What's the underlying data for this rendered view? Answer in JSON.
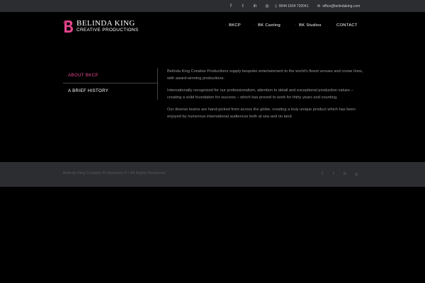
{
  "topbar": {
    "social_icons": [
      "f",
      "t",
      "in",
      "◎"
    ],
    "phone_icon": "▯",
    "phone": "0044 1604 720041",
    "email_icon": "✉",
    "email": "office@belindaking.com"
  },
  "logo": {
    "mark_letter": "B",
    "name": "BELINDA KING",
    "subtitle": "CREATIVE PRODUCTIONS"
  },
  "nav": {
    "items": [
      {
        "label": "BKCP",
        "bullet": "◦"
      },
      {
        "label": "BK Casting",
        "bullet": "◦"
      },
      {
        "label": "BK Studios",
        "bullet": "◦"
      },
      {
        "label": "CONTACT",
        "bullet": ""
      }
    ]
  },
  "side_menu": {
    "items": [
      {
        "label": "ABOUT BKCP",
        "active": true
      },
      {
        "label": "A BRIEF HISTORY",
        "active": false
      }
    ]
  },
  "content": {
    "paragraphs": [
      "Belinda King Creative Productions supply bespoke entertainment to the world's finest venues and cruise lines, with award-winning productions.",
      "Internationally recognised for our professionalism, attention to detail and exceptional production values – creating a solid foundation for success – which has proved to work for thirty years and counting.",
      "Our diverse teams are hand-picked from across the globe, creating a truly unique product which has been enjoyed by numerous international audiences both at sea and on land."
    ]
  },
  "footer": {
    "copyright": "Belinda King Creative Productions © | All Rights Reserved",
    "social_icons": [
      "f",
      "t",
      "in",
      "◎"
    ]
  },
  "colors": {
    "accent": "#e8468f",
    "bar_bg": "#2b2d30",
    "page_bg": "#000000"
  }
}
